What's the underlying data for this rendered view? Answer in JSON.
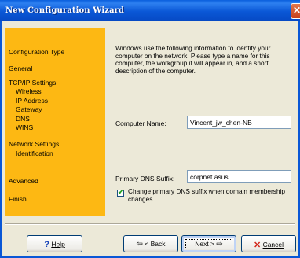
{
  "window": {
    "title": "New Configuration Wizard"
  },
  "nav": {
    "items": [
      {
        "label": "Configuration Type"
      },
      {
        "label": "General"
      },
      {
        "label": "TCP/IP Settings"
      },
      {
        "label": "Wireless"
      },
      {
        "label": "IP Address"
      },
      {
        "label": "Gateway"
      },
      {
        "label": "DNS"
      },
      {
        "label": "WINS"
      },
      {
        "label": "Network Settings"
      },
      {
        "label": "Identification"
      },
      {
        "label": "Advanced"
      },
      {
        "label": "Finish"
      }
    ]
  },
  "content": {
    "intro": "Windows use the following information to identify your computer on the network. Please type a name for this computer, the workgroup it will appear in, and a short description of the computer.",
    "computer_name_label": "Computer Name:",
    "computer_name_value": "Vincent_jw_chen-NB",
    "dns_suffix_label": "Primary DNS Suffix:",
    "dns_suffix_value": "corpnet.asus",
    "change_dns_label": "Change primary DNS suffix when domain membership changes",
    "change_dns_checked": true
  },
  "buttons": {
    "help": "Help",
    "back": "< Back",
    "next": "Next >",
    "cancel": "Cancel"
  },
  "colors": {
    "sidebar": "#fdb813",
    "titlebar": "#0a57d6"
  }
}
